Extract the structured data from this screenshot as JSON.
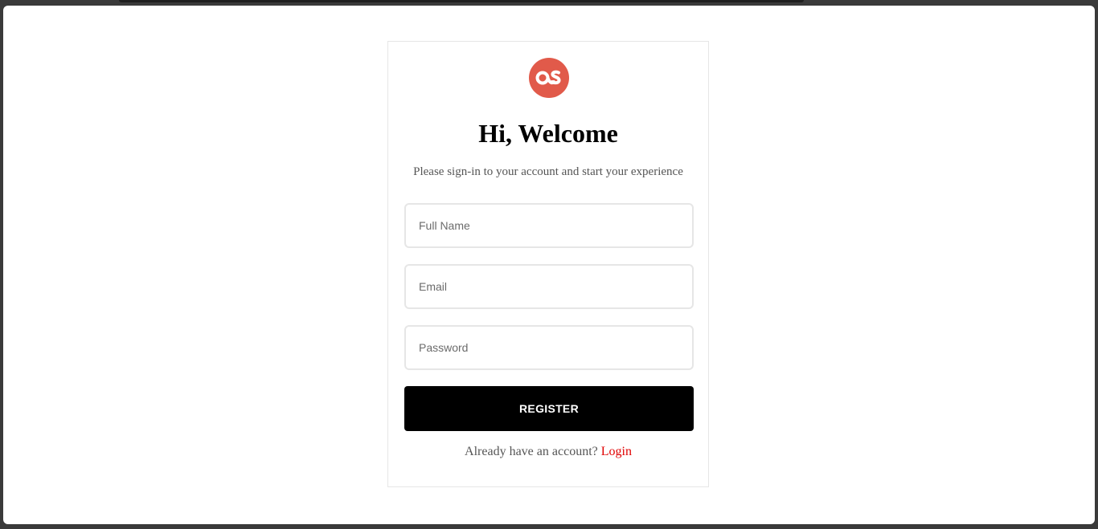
{
  "brand": {
    "logo_icon": "lastfm-logo-icon",
    "logo_color": "#e15a4a"
  },
  "header": {
    "title": "Hi, Welcome",
    "subtitle": "Please sign-in to your account and start your experience"
  },
  "form": {
    "full_name": {
      "value": "",
      "placeholder": "Full Name"
    },
    "email": {
      "value": "",
      "placeholder": "Email"
    },
    "password": {
      "value": "",
      "placeholder": "Password"
    },
    "register_label": "REGISTER"
  },
  "footer": {
    "prompt": "Already have an account?",
    "login_label": "Login",
    "login_color": "#e00000"
  }
}
